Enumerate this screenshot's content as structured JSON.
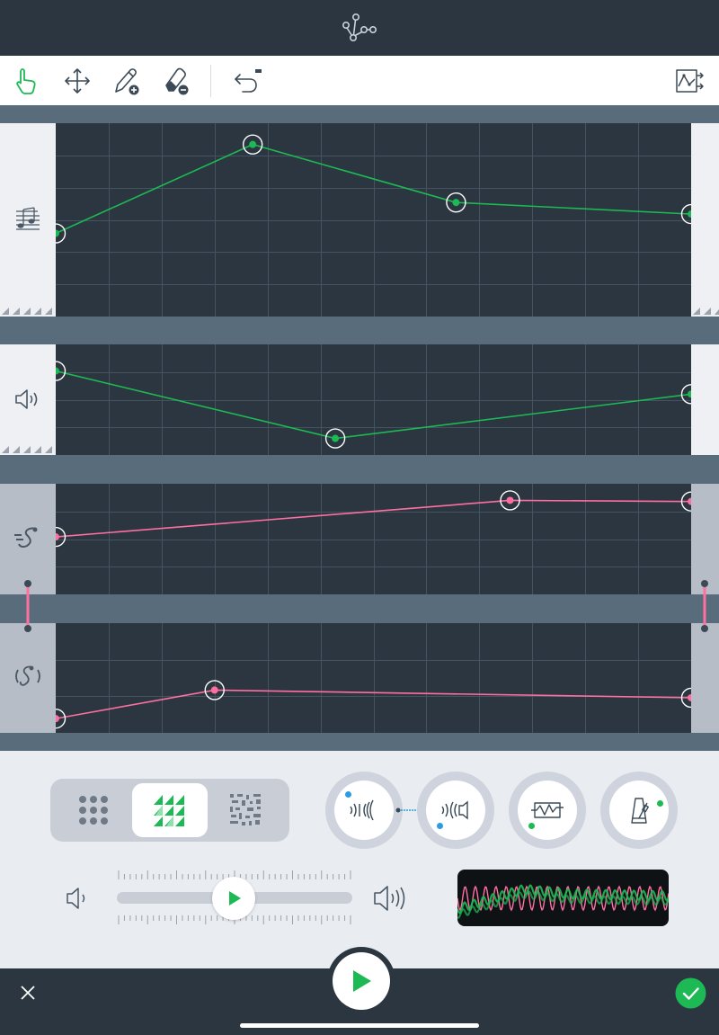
{
  "header": {
    "logo_icon": "node-graph-icon"
  },
  "toolbar": {
    "tools": [
      {
        "name": "pointer-hand-icon",
        "selected": true
      },
      {
        "name": "move-arrows-icon",
        "selected": false
      },
      {
        "name": "pencil-add-icon",
        "selected": false
      },
      {
        "name": "eraser-remove-icon",
        "selected": false
      },
      {
        "name": "undo-icon",
        "selected": false
      }
    ],
    "right_tool": "shuffle-curve-icon"
  },
  "colors": {
    "green": "#1db954",
    "pink": "#ff6fa0",
    "grid_bg": "#2b3640",
    "grid_line": "#44535f",
    "accent_blue": "#2a9de0"
  },
  "lanes": [
    {
      "id": "pitch",
      "icon": "music-notes-icon",
      "color": "green",
      "points": [
        [
          0,
          0.57
        ],
        [
          0.31,
          0.11
        ],
        [
          0.63,
          0.41
        ],
        [
          1,
          0.47
        ]
      ]
    },
    {
      "id": "volume",
      "icon": "speaker-icon",
      "color": "green",
      "points": [
        [
          0,
          0.24
        ],
        [
          0.44,
          0.85
        ],
        [
          1,
          0.45
        ]
      ]
    },
    {
      "id": "mod-a",
      "icon": "swirl-note-icon",
      "color": "pink",
      "points": [
        [
          0,
          0.48
        ],
        [
          0.715,
          0.15
        ],
        [
          1,
          0.16
        ]
      ]
    },
    {
      "id": "mod-b",
      "icon": "sound-wave-note-icon",
      "color": "pink",
      "points": [
        [
          0,
          0.87
        ],
        [
          0.25,
          0.61
        ],
        [
          1,
          0.68
        ]
      ]
    }
  ],
  "controls": {
    "view_modes": [
      {
        "name": "dots-grid-icon",
        "selected": false
      },
      {
        "name": "triangle-grid-icon",
        "selected": true
      },
      {
        "name": "noise-grid-icon",
        "selected": false
      }
    ],
    "knobs": [
      {
        "name": "sound-in-icon"
      },
      {
        "name": "sound-out-icon"
      },
      {
        "name": "waveform-box-icon"
      },
      {
        "name": "metronome-icon"
      }
    ],
    "preview_volume": 0.45
  },
  "footer": {
    "close_icon": "close-icon",
    "play_icon": "play-icon",
    "confirm_icon": "checkmark-icon"
  }
}
